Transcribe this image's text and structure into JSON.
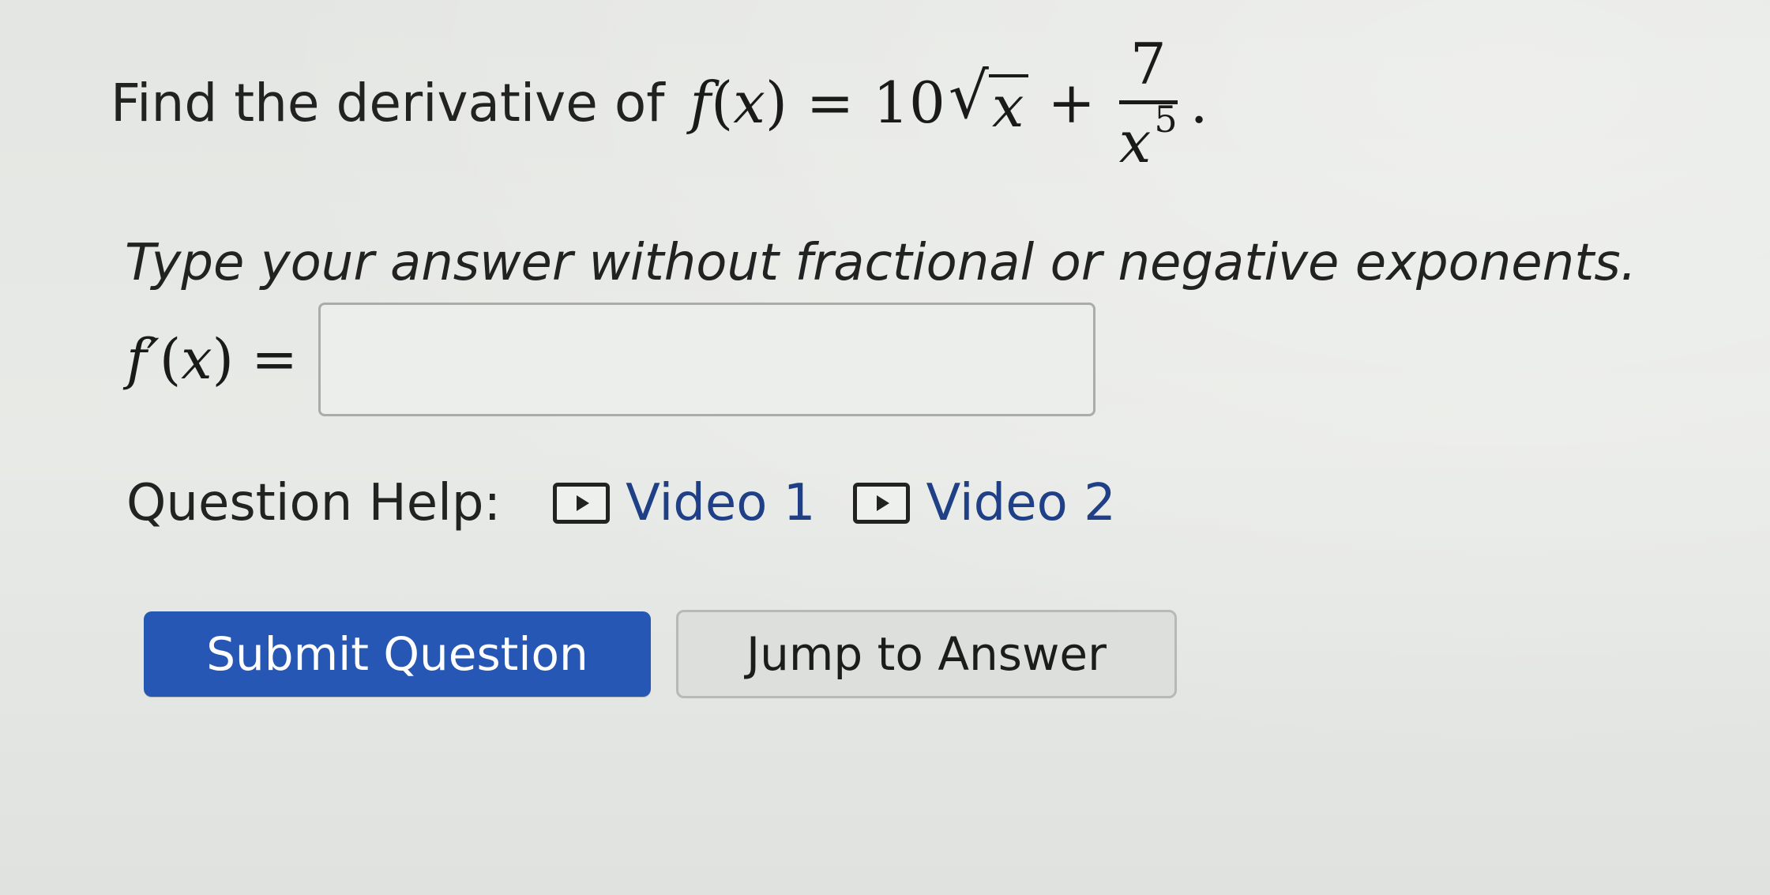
{
  "question": {
    "prompt": "Find the derivative of",
    "function_lhs": "f",
    "function_var": "x",
    "equals": "=",
    "coefficient": "10",
    "radicand": "x",
    "plus": "+",
    "frac_numerator": "7",
    "frac_denominator_base": "x",
    "frac_denominator_exp": "5",
    "period": "."
  },
  "instruction": "Type your answer without fractional or negative exponents.",
  "answer": {
    "label_fn": "f′",
    "label_var": "x",
    "equals": "=",
    "value": "",
    "placeholder": ""
  },
  "help": {
    "label": "Question Help:",
    "videos": [
      {
        "label": "Video 1",
        "icon": "play-icon"
      },
      {
        "label": "Video 2",
        "icon": "play-icon"
      }
    ]
  },
  "buttons": {
    "submit_label": "Submit Question",
    "jump_label": "Jump to Answer"
  },
  "colors": {
    "primary_button": "#2757b4",
    "link": "#1f3f86"
  }
}
